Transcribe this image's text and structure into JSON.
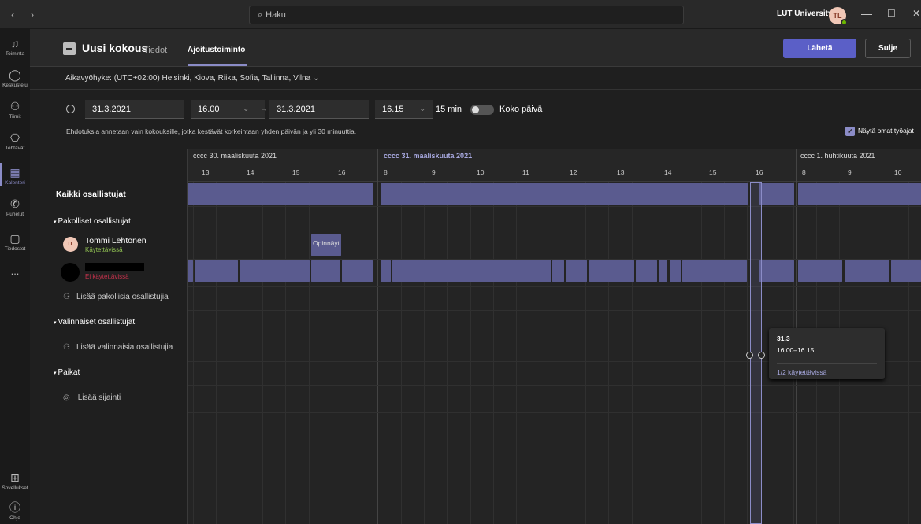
{
  "titlebar": {
    "nav": "‹ ›",
    "search_placeholder": "Haku",
    "org": "LUT University",
    "avatar": "TL",
    "min": "—",
    "max": "☐",
    "close": "✕"
  },
  "rail": [
    {
      "label": "Toiminta",
      "icon": "bell-icon"
    },
    {
      "label": "Keskustelu",
      "icon": "chat-icon"
    },
    {
      "label": "Tiimit",
      "icon": "teams-icon"
    },
    {
      "label": "Tehtävät",
      "icon": "tasks-icon"
    },
    {
      "label": "Kalenteri",
      "icon": "calendar-icon"
    },
    {
      "label": "Puhelut",
      "icon": "phone-icon"
    },
    {
      "label": "Tiedostot",
      "icon": "files-icon"
    },
    {
      "label": "...",
      "icon": "more-icon"
    },
    {
      "label": "Sovellukset",
      "icon": "apps-icon"
    },
    {
      "label": "Ohje",
      "icon": "help-icon"
    }
  ],
  "header": {
    "title": "Uusi kokous",
    "tab1": "Tiedot",
    "tab2": "Ajoitustoiminto",
    "send": "Lähetä",
    "close": "Sulje"
  },
  "timezone": "Aikavyöhyke: (UTC+02:00) Helsinki, Kiova, Riika, Sofia, Tallinna, Vilna",
  "datetime": {
    "start_date": "31.3.2021",
    "start_time": "16.00",
    "end_date": "31.3.2021",
    "end_time": "16.15",
    "duration": "15 min",
    "allday": "Koko päivä",
    "hint": "Ehdotuksia annetaan vain kokouksille, jotka kestävät korkeintaan yhden päivän ja yli 30 minuuttia.",
    "own_hours": "Näytä omat työajat"
  },
  "left": {
    "all": "Kaikki osallistujat",
    "required": "Pakolliset osallistujat",
    "p1_name": "Tommi Lehtonen",
    "p1_status": "Käytettävissä",
    "p1_initials": "TL",
    "p2_status": "Ei käytettävissä",
    "add_required": "Lisää pakollisia osallistujia",
    "optional": "Valinnaiset osallistujat",
    "add_optional": "Lisää valinnaisia osallistujia",
    "places": "Paikat",
    "add_place": "Lisää sijainti"
  },
  "grid": {
    "day1": "cccc 30. maaliskuuta 2021",
    "day2": "cccc 31. maaliskuuta 2021",
    "day3": "cccc 1. huhtikuuta 2021",
    "busy_label": "Opinnäyt"
  },
  "tooltip": {
    "date": "31.3",
    "time": "16.00–16.15",
    "avail": "1/2 käytettävissä"
  }
}
